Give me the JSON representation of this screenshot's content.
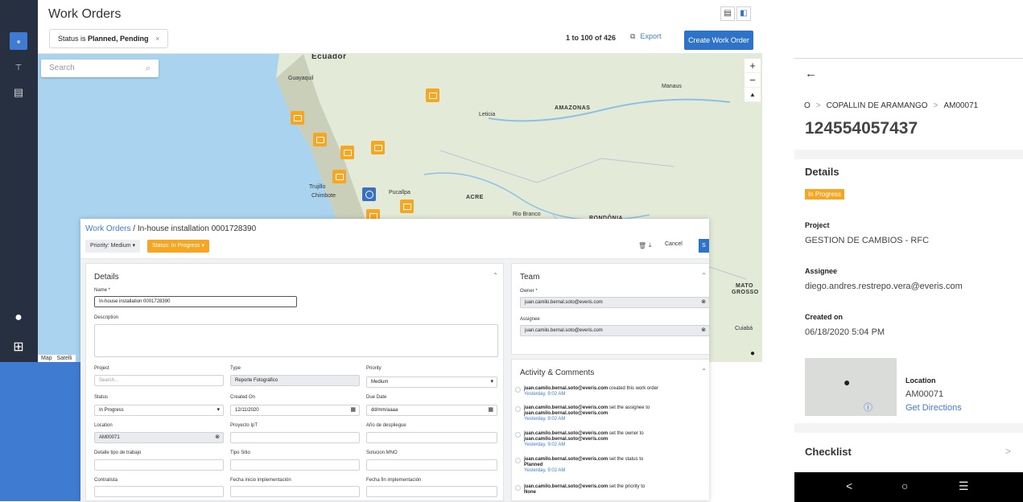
{
  "app": {
    "title": "Work Orders",
    "filter_chip": {
      "prefix": "Status is ",
      "value": "Planned, Pending",
      "close": "×"
    },
    "paging": "1 to 100 of 426",
    "export": "Export",
    "create_button": "Create Work Order",
    "search_placeholder": "Search",
    "zoom_in": "+",
    "zoom_out": "−",
    "compass": "▲",
    "map_tabs": {
      "map": "Map",
      "satellite": "Satelli"
    },
    "map_labels": {
      "ecuador": "Ecuador",
      "guayaquil": "Guayaquil",
      "manaus": "Manaus",
      "amazonas": "AMAZONAS",
      "leticia": "Leticia",
      "trujillo": "Trujillo",
      "chimbote": "Chimbote",
      "pucallpa": "Pucallpa",
      "acre": "ACRE",
      "rio_branco": "Rio Branco",
      "rondonia": "RONDÔNIA",
      "mato": "MATO",
      "grosso": "GROSSO",
      "cuiaba": "Cuiabá"
    }
  },
  "detail": {
    "breadcrumb_link": "Work Orders",
    "breadcrumb_sep": " / ",
    "breadcrumb_current": "In-house installation 0001728390",
    "priority_pill": "Priority: Medium  ▾",
    "status_pill": "Status: In Progress  ▾",
    "cancel": "Cancel",
    "save": "S",
    "details_title": "Details",
    "name_label": "Name *",
    "name_value": "In-house installation 0001728390",
    "description_label": "Description",
    "fields": {
      "project_label": "Project",
      "project_placeholder": "Search...",
      "type_label": "Type",
      "type_value": "Reporte Fotográfico",
      "priority_label": "Priority",
      "priority_value": "Medium",
      "status_label": "Status",
      "status_value": "In Progress",
      "created_label": "Created On",
      "created_value": "12/11/2020",
      "due_label": "Due Date",
      "due_placeholder": "dd/mm/aaaa",
      "location_label": "Location",
      "location_value": "AM00071",
      "proyecto_label": "Proyecto IpT",
      "anio_label": "Año de despliegue",
      "detalle_label": "Detalle tipo de trabajo",
      "tipo_sitio_label": "Tipo Sitio",
      "solucion_label": "Solucion MNO",
      "contratista_label": "Contratista",
      "fecha_inicio_label": "Fecha inicio implementación",
      "fecha_fin_label": "Fecha fin implementación"
    },
    "team_title": "Team",
    "owner_label": "Owner *",
    "owner_value": "juan.camilo.bernal.soto@everis.com",
    "assignee_label": "Assignee",
    "assignee_value": "juan.camilo.bernal.soto@everis.com",
    "activity_title": "Activity & Comments",
    "activities": [
      {
        "who": "juan.camilo.bernal.soto@everis.com",
        "what": " created this work order",
        "extra": "",
        "time": "Yesterday, 9:02 AM"
      },
      {
        "who": "juan.camilo.bernal.soto@everis.com",
        "what": " set the assignee to",
        "extra": "juan.camilo.bernal.soto@everis.com",
        "time": "Yesterday, 9:02 AM"
      },
      {
        "who": "juan.camilo.bernal.soto@everis.com",
        "what": " set the owner to",
        "extra": "juan.camilo.bernal.soto@everis.com",
        "time": "Yesterday, 9:02 AM"
      },
      {
        "who": "juan.camilo.bernal.soto@everis.com",
        "what": " set the status to",
        "extra": "Planned",
        "time": "Yesterday, 9:02 AM"
      },
      {
        "who": "juan.camilo.bernal.soto@everis.com",
        "what": " set the priority to",
        "extra": "None",
        "time": ""
      }
    ]
  },
  "mobile": {
    "back": "←",
    "crumb_1": "O",
    "crumb_2": "COPALLIN DE ARAMANGO",
    "crumb_3": "AM00071",
    "crumb_sep": ">",
    "title": "124554057437",
    "details_heading": "Details",
    "status": "In Progress",
    "project_label": "Project",
    "project_value": "GESTION DE CAMBIOS - RFC",
    "assignee_label": "Assignee",
    "assignee_value": "diego.andres.restrepo.vera@everis.com",
    "created_label": "Created on",
    "created_value": "06/18/2020 5:04 PM",
    "location_label": "Location",
    "location_value": "AM00071",
    "directions": "Get Directions",
    "checklist": "Checklist",
    "checklist_chev": ">",
    "nav_back": "<",
    "nav_home": "○",
    "nav_menu": "☰"
  },
  "colors": {
    "accent": "#2f73c9",
    "pin_orange": "#f5a623",
    "sidebar": "#263040",
    "band": "#3e7bd1"
  }
}
